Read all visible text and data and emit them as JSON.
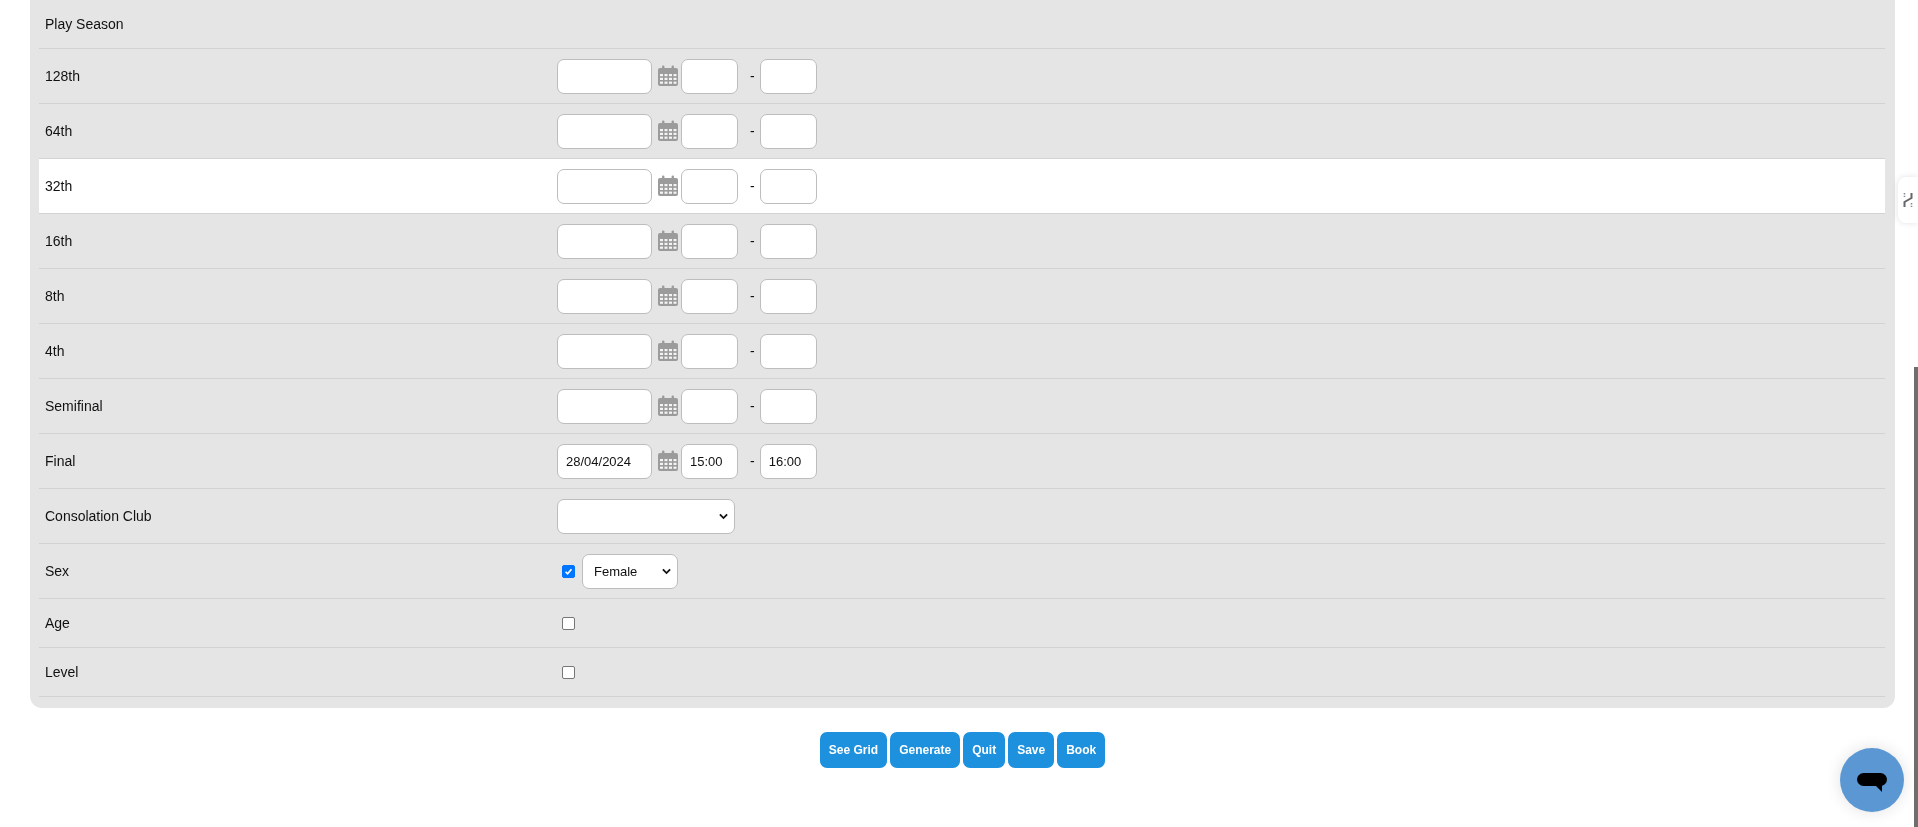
{
  "form": {
    "rows": [
      {
        "kind": "heading",
        "label": "Play Season",
        "highlighted": false
      },
      {
        "kind": "datetime",
        "label": "128th",
        "highlighted": false,
        "separator": "-"
      },
      {
        "kind": "datetime",
        "label": "64th",
        "highlighted": false,
        "separator": "-"
      },
      {
        "kind": "datetime",
        "label": "32th",
        "highlighted": true,
        "separator": "-"
      },
      {
        "kind": "datetime",
        "label": "16th",
        "highlighted": false,
        "separator": "-"
      },
      {
        "kind": "datetime",
        "label": "8th",
        "highlighted": false,
        "separator": "-"
      },
      {
        "kind": "datetime",
        "label": "4th",
        "highlighted": false,
        "separator": "-"
      },
      {
        "kind": "datetime",
        "label": "Semifinal",
        "highlighted": false,
        "separator": "-"
      },
      {
        "kind": "datetime",
        "label": "Final",
        "highlighted": false,
        "date": "28/04/2024",
        "start": "15:00",
        "end": "16:00",
        "separator": "-"
      },
      {
        "kind": "select",
        "label": "Consolation Club",
        "highlighted": false
      },
      {
        "kind": "checkbox-select",
        "label": "Sex",
        "highlighted": false,
        "checked": true,
        "value": "Female"
      },
      {
        "kind": "checkbox",
        "label": "Age",
        "highlighted": false,
        "checked": false
      },
      {
        "kind": "checkbox",
        "label": "Level",
        "highlighted": false,
        "checked": false
      }
    ]
  },
  "actions": [
    {
      "label": "See Grid"
    },
    {
      "label": "Generate"
    },
    {
      "label": "Quit"
    },
    {
      "label": "Save"
    },
    {
      "label": "Book"
    }
  ]
}
